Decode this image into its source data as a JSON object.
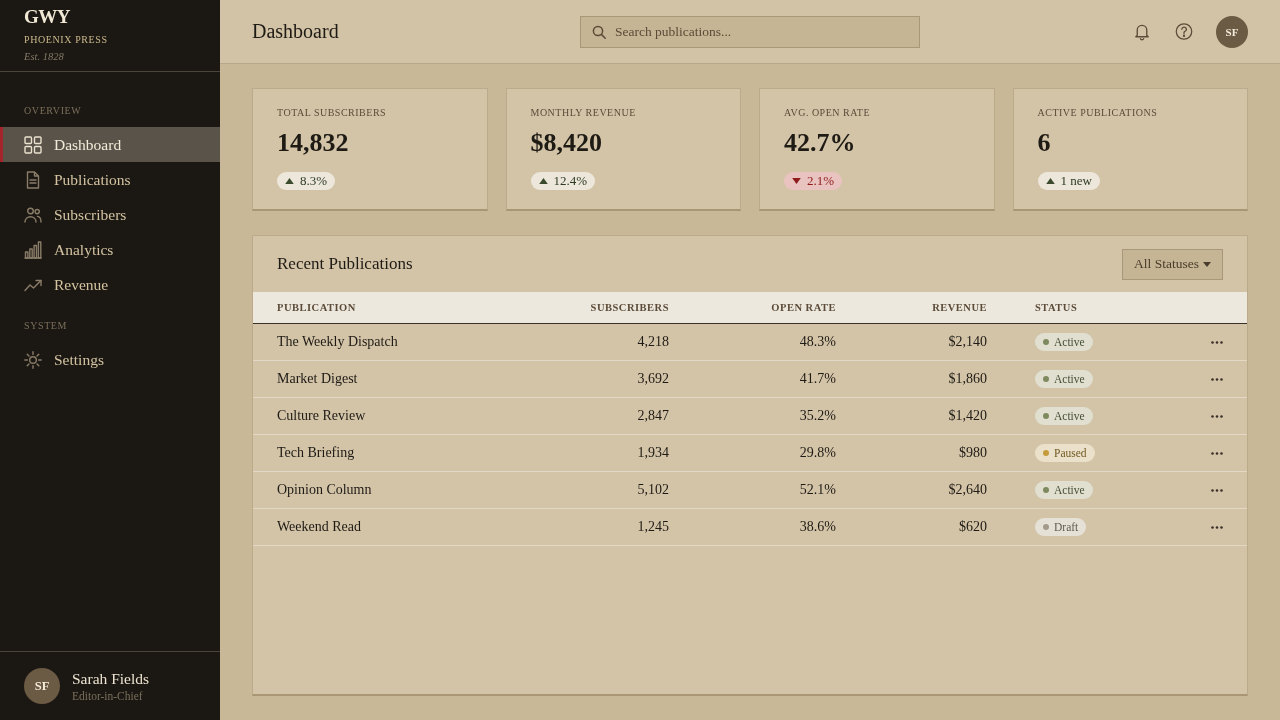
{
  "sidebar": {
    "logo": "GWY",
    "brand": "PHOENIX PRESS",
    "tagline": "Est. 1828",
    "sections": [
      {
        "label": "OVERVIEW",
        "items": [
          {
            "label": "Dashboard",
            "selected": true
          },
          {
            "label": "Publications",
            "selected": false
          },
          {
            "label": "Subscribers",
            "selected": false
          },
          {
            "label": "Analytics",
            "selected": false
          },
          {
            "label": "Revenue",
            "selected": false
          }
        ]
      },
      {
        "label": "SYSTEM",
        "items": [
          {
            "label": "Settings",
            "selected": false
          }
        ]
      }
    ],
    "user": {
      "initials": "SF",
      "name": "Sarah Fields",
      "role": "Editor-in-Chief"
    }
  },
  "header": {
    "title": "Dashboard",
    "search": {
      "placeholder": "Search publications..."
    },
    "avatar": "SF"
  },
  "stats": [
    {
      "label": "TOTAL SUBSCRIBERS",
      "value": "14,832",
      "change": "8.3%",
      "kind": "increase"
    },
    {
      "label": "MONTHLY REVENUE",
      "value": "$8,420",
      "change": "12.4%",
      "kind": "increase"
    },
    {
      "label": "AVG. OPEN RATE",
      "value": "42.7%",
      "change": "2.1%",
      "kind": "decrease"
    },
    {
      "label": "ACTIVE PUBLICATIONS",
      "value": "6",
      "change": "1 new",
      "kind": "increase"
    }
  ],
  "table": {
    "title": "Recent Publications",
    "filter": "All Statuses",
    "columns": [
      "PUBLICATION",
      "SUBSCRIBERS",
      "OPEN RATE",
      "REVENUE",
      "STATUS"
    ],
    "rows": [
      {
        "publication": "The Weekly Dispatch",
        "subscribers": "4,218",
        "open_rate": "48.3%",
        "revenue": "$2,140",
        "status": {
          "label": "Active",
          "color": "#7e8a5e"
        }
      },
      {
        "publication": "Market Digest",
        "subscribers": "3,692",
        "open_rate": "41.7%",
        "revenue": "$1,860",
        "status": {
          "label": "Active",
          "color": "#7e8a5e"
        }
      },
      {
        "publication": "Culture Review",
        "subscribers": "2,847",
        "open_rate": "35.2%",
        "revenue": "$1,420",
        "status": {
          "label": "Active",
          "color": "#7e8a5e"
        }
      },
      {
        "publication": "Tech Briefing",
        "subscribers": "1,934",
        "open_rate": "29.8%",
        "revenue": "$980",
        "status": {
          "label": "Paused",
          "color": "#c49a3a"
        }
      },
      {
        "publication": "Opinion Column",
        "subscribers": "5,102",
        "open_rate": "52.1%",
        "revenue": "$2,640",
        "status": {
          "label": "Active",
          "color": "#7e8a5e"
        }
      },
      {
        "publication": "Weekend Read",
        "subscribers": "1,245",
        "open_rate": "38.6%",
        "revenue": "$620",
        "status": {
          "label": "Draft",
          "color": "#a49a8a"
        }
      }
    ]
  }
}
